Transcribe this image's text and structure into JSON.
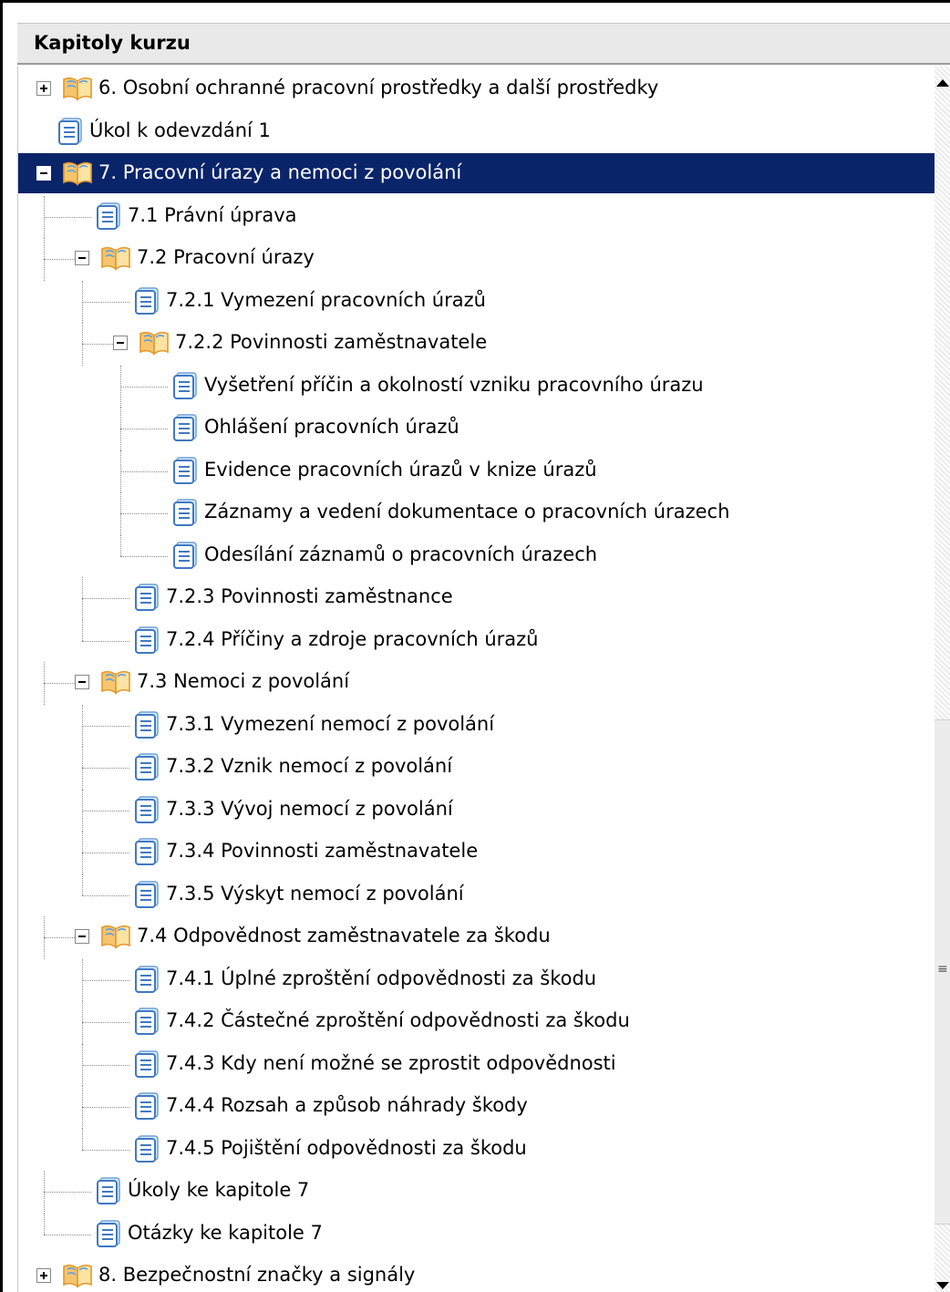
{
  "header": {
    "title": "Kapitoly kurzu"
  },
  "tree": [
    {
      "id": "n1",
      "label": "6. Osobní ochranné pracovní prostředky a další prostředky",
      "depth": 0,
      "kind": "book",
      "toggle": "plus"
    },
    {
      "id": "n2",
      "label": "Úkol k odevzdání 1",
      "depth": 0,
      "kind": "doc"
    },
    {
      "id": "n3",
      "label": "7. Pracovní úrazy a nemoci z povolání",
      "depth": 0,
      "kind": "book",
      "toggle": "minus",
      "selected": true
    },
    {
      "id": "n4",
      "label": "7.1 Právní úprava",
      "depth": 1,
      "kind": "doc"
    },
    {
      "id": "n5",
      "label": "7.2 Pracovní úrazy",
      "depth": 1,
      "kind": "book",
      "toggle": "minus"
    },
    {
      "id": "n6",
      "label": "7.2.1 Vymezení pracovních úrazů",
      "depth": 2,
      "kind": "doc"
    },
    {
      "id": "n7",
      "label": "7.2.2 Povinnosti zaměstnavatele",
      "depth": 2,
      "kind": "book",
      "toggle": "minus"
    },
    {
      "id": "n8",
      "label": "Vyšetření příčin a okolností vzniku pracovního úrazu",
      "depth": 3,
      "kind": "doc"
    },
    {
      "id": "n9",
      "label": "Ohlášení pracovních úrazů",
      "depth": 3,
      "kind": "doc"
    },
    {
      "id": "n10",
      "label": "Evidence pracovních úrazů v knize úrazů",
      "depth": 3,
      "kind": "doc"
    },
    {
      "id": "n11",
      "label": "Záznamy a vedení dokumentace o pracovních úrazech",
      "depth": 3,
      "kind": "doc"
    },
    {
      "id": "n12",
      "label": "Odesílání záznamů o pracovních úrazech",
      "depth": 3,
      "kind": "doc"
    },
    {
      "id": "n13",
      "label": "7.2.3 Povinnosti zaměstnance",
      "depth": 2,
      "kind": "doc"
    },
    {
      "id": "n14",
      "label": "7.2.4 Příčiny a zdroje pracovních úrazů",
      "depth": 2,
      "kind": "doc"
    },
    {
      "id": "n15",
      "label": "7.3 Nemoci z povolání",
      "depth": 1,
      "kind": "book",
      "toggle": "minus"
    },
    {
      "id": "n16",
      "label": "7.3.1 Vymezení nemocí z povolání",
      "depth": 2,
      "kind": "doc"
    },
    {
      "id": "n17",
      "label": "7.3.2 Vznik nemocí z povolání",
      "depth": 2,
      "kind": "doc"
    },
    {
      "id": "n18",
      "label": "7.3.3 Vývoj nemocí z povolání",
      "depth": 2,
      "kind": "doc"
    },
    {
      "id": "n19",
      "label": "7.3.4 Povinnosti zaměstnavatele",
      "depth": 2,
      "kind": "doc"
    },
    {
      "id": "n20",
      "label": "7.3.5 Výskyt nemocí z povolání",
      "depth": 2,
      "kind": "doc"
    },
    {
      "id": "n21",
      "label": "7.4 Odpovědnost zaměstnavatele za škodu",
      "depth": 1,
      "kind": "book",
      "toggle": "minus"
    },
    {
      "id": "n22",
      "label": "7.4.1 Úplné zproštění odpovědnosti za škodu",
      "depth": 2,
      "kind": "doc"
    },
    {
      "id": "n23",
      "label": "7.4.2 Částečné zproštění odpovědnosti za škodu",
      "depth": 2,
      "kind": "doc"
    },
    {
      "id": "n24",
      "label": "7.4.3 Kdy není možné se zprostit odpovědnosti",
      "depth": 2,
      "kind": "doc"
    },
    {
      "id": "n25",
      "label": "7.4.4 Rozsah a způsob náhrady škody",
      "depth": 2,
      "kind": "doc"
    },
    {
      "id": "n26",
      "label": "7.4.5 Pojištění odpovědnosti za škodu",
      "depth": 2,
      "kind": "doc"
    },
    {
      "id": "n27",
      "label": "Úkoly ke kapitole 7",
      "depth": 1,
      "kind": "doc"
    },
    {
      "id": "n28",
      "label": "Otázky ke kapitole 7",
      "depth": 1,
      "kind": "doc"
    },
    {
      "id": "n29",
      "label": "8. Bezpečnostní značky a signály",
      "depth": 0,
      "kind": "book",
      "toggle": "plus"
    }
  ],
  "colors": {
    "selection": "#0a246a",
    "book": "#e39a2c",
    "doc": "#3f78c2"
  }
}
